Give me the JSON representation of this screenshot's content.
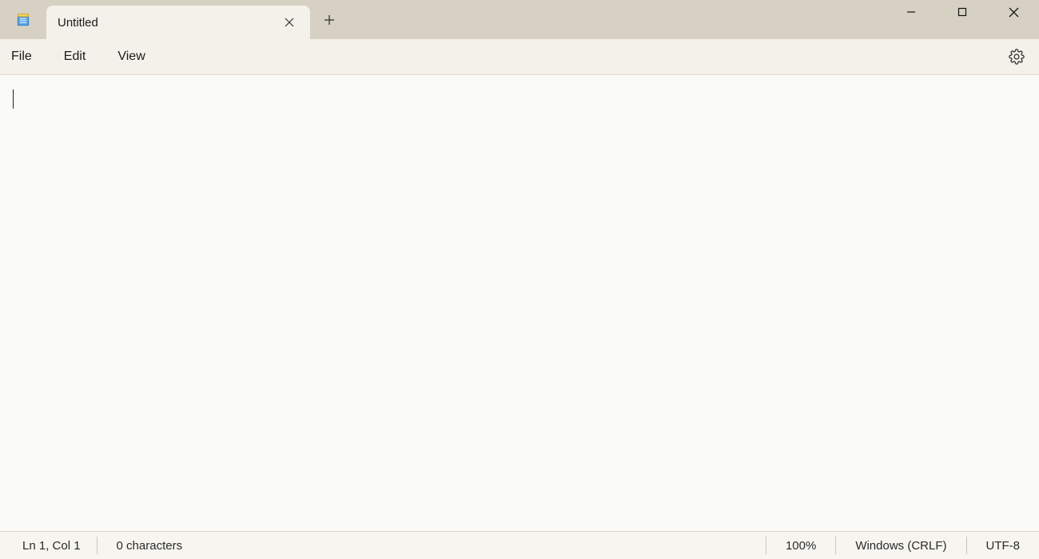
{
  "tabs": [
    {
      "title": "Untitled"
    }
  ],
  "menu": {
    "file": "File",
    "edit": "Edit",
    "view": "View"
  },
  "editor": {
    "content": ""
  },
  "status": {
    "position": "Ln 1, Col 1",
    "characters": "0 characters",
    "zoom": "100%",
    "line_ending": "Windows (CRLF)",
    "encoding": "UTF-8"
  }
}
